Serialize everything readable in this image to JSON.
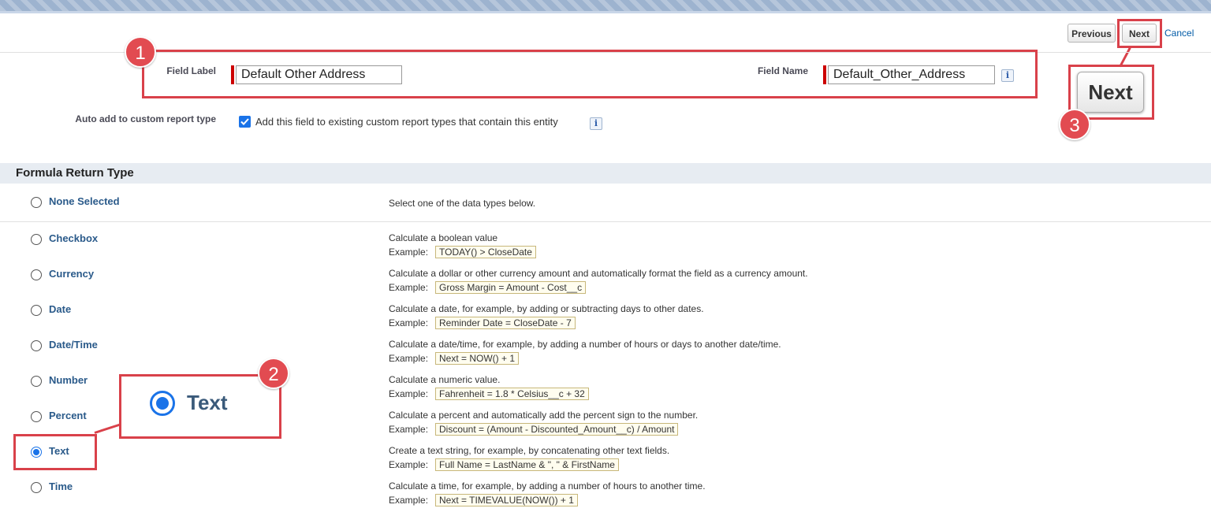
{
  "buttons": {
    "previous": "Previous",
    "next": "Next",
    "cancel": "Cancel",
    "next_zoom": "Next"
  },
  "fields": {
    "field_label": {
      "label": "Field Label",
      "value": "Default Other Address"
    },
    "field_name": {
      "label": "Field Name",
      "value": "Default_Other_Address"
    },
    "auto_add": {
      "label": "Auto add to custom report type",
      "text": "Add this field to existing custom report types that contain this entity",
      "checked": true
    }
  },
  "section_title": "Formula Return Type",
  "options": [
    {
      "label": "None Selected",
      "desc": "Select one of the data types below.",
      "example": ""
    },
    {
      "label": "Checkbox",
      "desc": "Calculate a boolean value",
      "example": "TODAY() > CloseDate"
    },
    {
      "label": "Currency",
      "desc": "Calculate a dollar or other currency amount and automatically format the field as a currency amount.",
      "example": "Gross Margin = Amount - Cost__c"
    },
    {
      "label": "Date",
      "desc": "Calculate a date, for example, by adding or subtracting days to other dates.",
      "example": "Reminder Date = CloseDate - 7"
    },
    {
      "label": "Date/Time",
      "desc": "Calculate a date/time, for example, by adding a number of hours or days to another date/time.",
      "example": "Next = NOW() + 1"
    },
    {
      "label": "Number",
      "desc": "Calculate a numeric value.",
      "example": "Fahrenheit = 1.8 * Celsius__c + 32"
    },
    {
      "label": "Percent",
      "desc": "Calculate a percent and automatically add the percent sign to the number.",
      "example": "Discount = (Amount - Discounted_Amount__c) / Amount"
    },
    {
      "label": "Text",
      "desc": "Create a text string, for example, by concatenating other text fields.",
      "example": "Full Name = LastName & \", \" & FirstName"
    },
    {
      "label": "Time",
      "desc": "Calculate a time, for example, by adding a number of hours to another time.",
      "example": "Next = TIMEVALUE(NOW()) + 1"
    }
  ],
  "selected_option": "Text",
  "example_label": "Example:",
  "callouts": {
    "c1": "1",
    "c2": "2",
    "c3": "3",
    "zoom_text": "Text"
  },
  "colors": {
    "callout_red": "#d9414a",
    "radio_blue": "#1a73e8",
    "label_blue": "#2a5a8a"
  }
}
